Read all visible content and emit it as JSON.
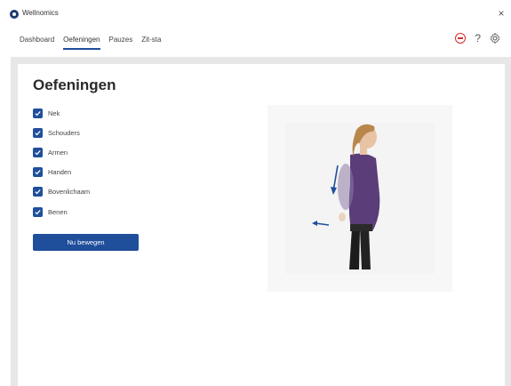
{
  "app": {
    "title": "Wellnomics",
    "close": "×"
  },
  "nav": {
    "tabs": [
      {
        "label": "Dashboard"
      },
      {
        "label": "Oefeningen",
        "active": true
      },
      {
        "label": "Pauzes"
      },
      {
        "label": "Zit-sta"
      }
    ],
    "icons": {
      "stop": "stop-icon",
      "help": "?",
      "settings": "gear-icon"
    }
  },
  "page": {
    "title": "Oefeningen",
    "options": [
      {
        "label": "Nek",
        "checked": true
      },
      {
        "label": "Schouders",
        "checked": true
      },
      {
        "label": "Armen",
        "checked": true
      },
      {
        "label": "Handen",
        "checked": true
      },
      {
        "label": "Bovenlichaam",
        "checked": true
      },
      {
        "label": "Benen",
        "checked": true
      }
    ],
    "button": "Nu bewegen"
  },
  "colors": {
    "accent": "#1f4e9b",
    "stop": "#d52b2b",
    "background": "#e7e7e7"
  }
}
